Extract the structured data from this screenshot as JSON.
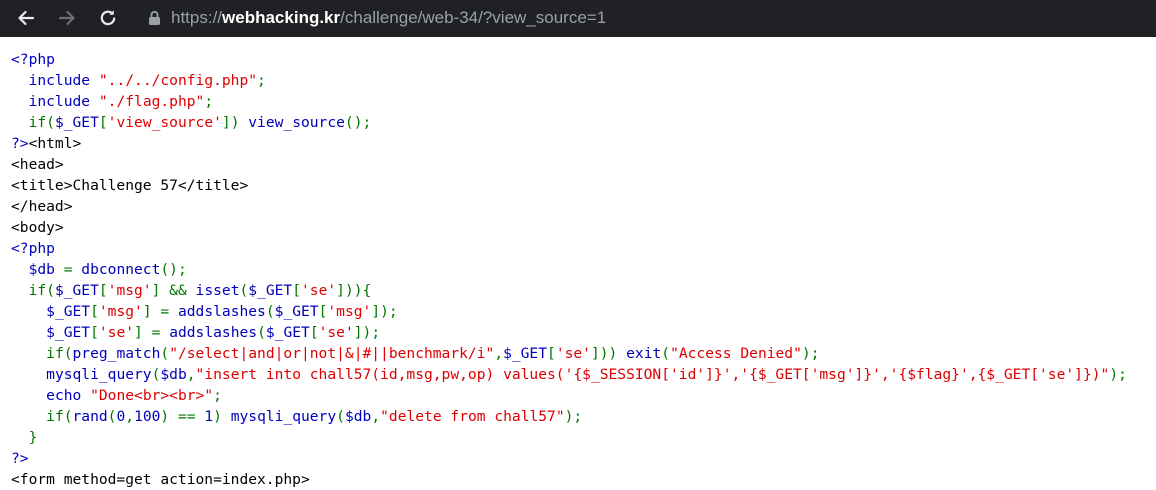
{
  "browser": {
    "url_scheme": "https://",
    "url_host": "webhacking.kr",
    "url_path": "/challenge/web-34/?view_source=1"
  },
  "source": {
    "l1": [
      "<?php"
    ],
    "l2": [
      "  ",
      "include",
      " ",
      "\"../../config.php\"",
      ";"
    ],
    "l3": [
      "  ",
      "include",
      " ",
      "\"./flag.php\"",
      ";"
    ],
    "l4": [
      "  ",
      "if(",
      "$_GET",
      "[",
      "'view_source'",
      "]) ",
      "view_source",
      "();"
    ],
    "l5": [
      "?>",
      "<html>"
    ],
    "l6": [
      "<head>"
    ],
    "l7": [
      "<title>Challenge 57</title>"
    ],
    "l8": [
      "</head>"
    ],
    "l9": [
      "<body>"
    ],
    "l10": [
      "<?php"
    ],
    "l11": [
      "  ",
      "$db",
      " = ",
      "dbconnect",
      "();"
    ],
    "l12": [
      "  ",
      "if(",
      "$_GET",
      "[",
      "'msg'",
      "] && ",
      "isset",
      "(",
      "$_GET",
      "[",
      "'se'",
      "])){"
    ],
    "l13": [
      "    ",
      "$_GET",
      "[",
      "'msg'",
      "] = ",
      "addslashes",
      "(",
      "$_GET",
      "[",
      "'msg'",
      "]);"
    ],
    "l14": [
      "    ",
      "$_GET",
      "[",
      "'se'",
      "] = ",
      "addslashes",
      "(",
      "$_GET",
      "[",
      "'se'",
      "]);"
    ],
    "l15": [
      "    ",
      "if(",
      "preg_match",
      "(",
      "\"/select|and|or|not|&|#||benchmark/i\"",
      ",",
      "$_GET",
      "[",
      "'se'",
      "])) ",
      "exit",
      "(",
      "\"Access Denied\"",
      ");"
    ],
    "l16": [
      "    ",
      "mysqli_query",
      "(",
      "$db",
      ",",
      "\"insert into chall57(id,msg,pw,op) values('{$_SESSION['id']}','{$_GET['msg']}','{$flag}',{$_GET['se']})\"",
      ");"
    ],
    "l17": [
      "    ",
      "echo",
      " ",
      "\"Done<br><br>\"",
      ";"
    ],
    "l18": [
      "    ",
      "if(",
      "rand",
      "(",
      "0",
      ",",
      "100",
      ") == ",
      "1",
      ") ",
      "mysqli_query",
      "(",
      "$db",
      ",",
      "\"delete from chall57\"",
      ");"
    ],
    "l19": [
      "  ",
      "}"
    ],
    "l20": [
      "?>"
    ],
    "l21": [
      "<form method=get action=index.php>"
    ]
  }
}
